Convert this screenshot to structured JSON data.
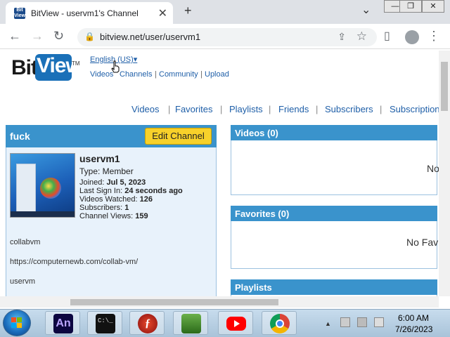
{
  "browser": {
    "tab_title": "BitView - uservm1's Channel",
    "favicon_text": "Bit View",
    "new_tab": "+",
    "tab_close": "✕",
    "tab_search": "⌄",
    "window_buttons": [
      "—",
      "❐",
      "✕"
    ],
    "url": "bitview.net/user/uservm1",
    "back": "←",
    "forward": "→",
    "reload": "↻",
    "lock": "🔒",
    "share": "⇪",
    "bookmark": "☆",
    "sidepanel": "▯",
    "menu": "⋮"
  },
  "site": {
    "logo_bit": "Bit",
    "logo_view": "View",
    "logo_tm": "TM",
    "language": "English (US)",
    "language_arrow": "▾",
    "top_links": [
      "Videos",
      "Channels",
      "Community",
      "Upload"
    ],
    "nav": [
      "Videos",
      "Favorites",
      "Playlists",
      "Friends",
      "Subscribers",
      "Subscriptions"
    ]
  },
  "profile": {
    "box_title": "fuck",
    "edit_button": "Edit Channel",
    "username": "uservm1",
    "type_label": "Type: Member",
    "joined_label": "Joined:",
    "joined_value": "Jul 5, 2023",
    "last_signin_label": "Last Sign In:",
    "last_signin_value": "24 seconds ago",
    "videos_watched_label": "Videos Watched:",
    "videos_watched_value": "126",
    "subscribers_label": "Subscribers:",
    "subscribers_value": "1",
    "channel_views_label": "Channel Views:",
    "channel_views_value": "159",
    "about_lines": [
      "collabvm",
      "https://computernewb.com/collab-vm/",
      "uservm"
    ]
  },
  "panels": {
    "videos_title": "Videos (0)",
    "videos_empty": "No",
    "favorites_title": "Favorites (0)",
    "favorites_empty": "No Fav",
    "playlists_title": "Playlists"
  },
  "taskbar": {
    "apps": [
      "animate",
      "terminal",
      "flash",
      "network",
      "youtube",
      "chrome"
    ],
    "time": "6:00 AM",
    "date": "7/26/2023",
    "tray_arrow": "▲"
  }
}
